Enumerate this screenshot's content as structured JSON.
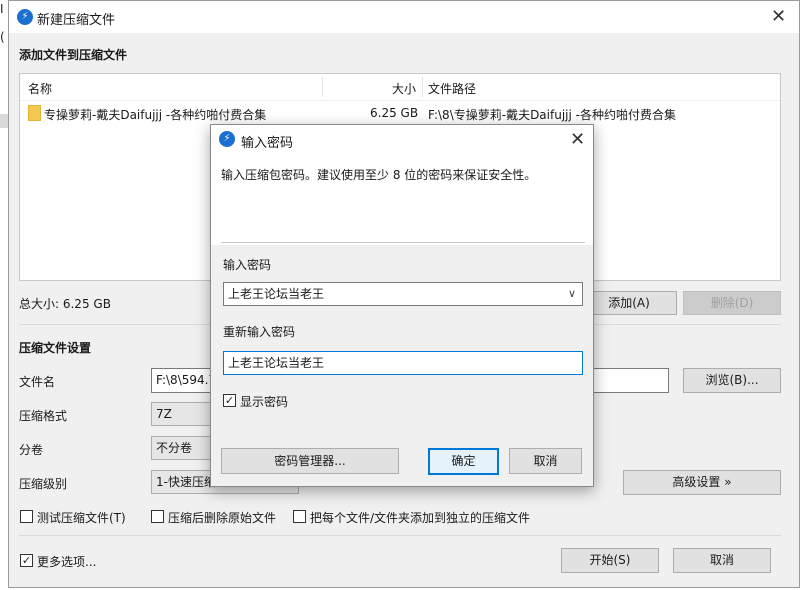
{
  "background": {
    "fragments": [
      "I",
      "(",
      "莉"
    ]
  },
  "window": {
    "title": "新建压缩文件",
    "close_label": "✕"
  },
  "add_files": {
    "section_title": "添加文件到压缩文件",
    "columns": {
      "name": "名称",
      "size": "大小",
      "path": "文件路径"
    },
    "rows": [
      {
        "name": "专操萝莉-戴夫Daifujjj -各种约啪付费合集",
        "size": "6.25 GB",
        "path": "F:\\8\\专操萝莉-戴夫Daifujjj -各种约啪付费合集"
      }
    ],
    "total_size": "总大小: 6.25 GB",
    "add_button": "添加(A)",
    "delete_button": "删除(D)"
  },
  "settings": {
    "section_title": "压缩文件设置",
    "filename_label": "文件名",
    "filename_value": "F:\\8\\594.7",
    "browse_button": "浏览(B)...",
    "format_label": "压缩格式",
    "format_value": "7Z",
    "split_label": "分卷",
    "split_value": "不分卷",
    "level_label": "压缩级别",
    "level_value": "1-快速压缩",
    "advanced_button": "高级设置 »",
    "options": [
      {
        "label": "测试压缩文件(T)",
        "checked": false
      },
      {
        "label": "压缩后删除原始文件",
        "checked": false
      },
      {
        "label": "把每个文件/文件夹添加到独立的压缩文件",
        "checked": false
      }
    ],
    "more_options": {
      "label": "更多选项...",
      "checked": true
    }
  },
  "footer": {
    "start_button": "开始(S)",
    "cancel_button": "取消"
  },
  "password_dialog": {
    "title": "输入密码",
    "close_label": "✕",
    "description": "输入压缩包密码。建议使用至少 8 位的密码来保证安全性。",
    "password_label": "输入密码",
    "password_value": "上老王论坛当老王",
    "reenter_label": "重新输入密码",
    "reenter_value": "上老王论坛当老王",
    "show_password": {
      "label": "显示密码",
      "checked": true
    },
    "manager_button": "密码管理器...",
    "ok_button": "确定",
    "cancel_button": "取消"
  },
  "colors": {
    "accent": "#0078d7",
    "icon_blue": "#1a6fd1",
    "folder": "#f2c94c"
  }
}
